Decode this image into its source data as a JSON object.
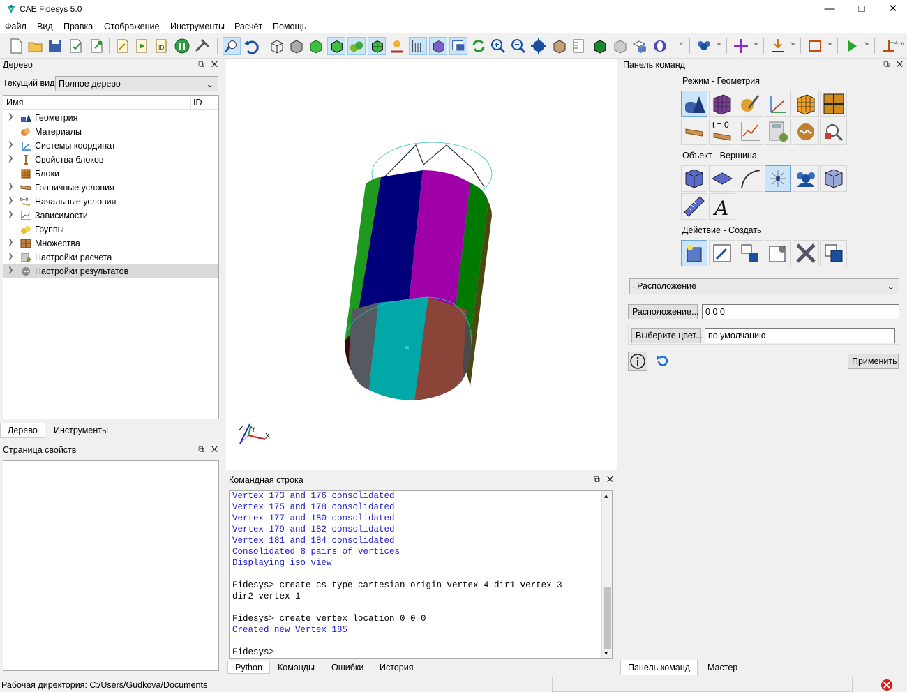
{
  "window": {
    "title": "CAE Fidesys 5.0"
  },
  "menu": [
    "Файл",
    "Вид",
    "Правка",
    "Отображение",
    "Инструменты",
    "Расчёт",
    "Помощь"
  ],
  "tree_panel": {
    "title": "Дерево",
    "view_label": "Текущий вид",
    "view_value": "Полное дерево",
    "col_name": "Имя",
    "col_id": "ID",
    "items": [
      {
        "label": "Геометрия",
        "icon": "geometry-icon"
      },
      {
        "label": "Материалы",
        "icon": "materials-icon"
      },
      {
        "label": "Системы координат",
        "icon": "coordinate-systems-icon"
      },
      {
        "label": "Свойства блоков",
        "icon": "block-properties-icon"
      },
      {
        "label": "Блоки",
        "icon": "blocks-icon"
      },
      {
        "label": "Граничные условия",
        "icon": "boundary-conditions-icon"
      },
      {
        "label": "Начальные условия",
        "icon": "initial-conditions-icon"
      },
      {
        "label": "Зависимости",
        "icon": "dependencies-icon"
      },
      {
        "label": "Группы",
        "icon": "groups-icon"
      },
      {
        "label": "Множества",
        "icon": "sets-icon"
      },
      {
        "label": "Настройки расчета",
        "icon": "calc-settings-icon"
      },
      {
        "label": "Настройки результатов",
        "icon": "results-settings-icon"
      }
    ],
    "tabs": [
      "Дерево",
      "Инструменты"
    ]
  },
  "props_panel": {
    "title": "Страница свойств"
  },
  "cmdline": {
    "title": "Командная строка",
    "lines": [
      {
        "text": "Vertex 173 and 176 consolidated",
        "kind": "out"
      },
      {
        "text": "Vertex 175 and 178 consolidated",
        "kind": "out"
      },
      {
        "text": "Vertex 177 and 180 consolidated",
        "kind": "out"
      },
      {
        "text": "Vertex 179 and 182 consolidated",
        "kind": "out"
      },
      {
        "text": "Vertex 181 and 184 consolidated",
        "kind": "out"
      },
      {
        "text": "Consolidated 8 pairs of vertices",
        "kind": "out"
      },
      {
        "text": "Displaying iso view",
        "kind": "out"
      },
      {
        "text": "",
        "kind": "blank"
      },
      {
        "text": "Fidesys> create cs type cartesian origin vertex 4 dir1 vertex 3",
        "kind": "cmd"
      },
      {
        "text": "dir2 vertex 1",
        "kind": "cmd"
      },
      {
        "text": "",
        "kind": "blank"
      },
      {
        "text": "Fidesys> create vertex location 0 0 0",
        "kind": "cmd"
      },
      {
        "text": "Created new Vertex 185",
        "kind": "out"
      },
      {
        "text": "",
        "kind": "blank"
      },
      {
        "text": "Fidesys>",
        "kind": "cmd"
      }
    ],
    "tabs": [
      "Python",
      "Команды",
      "Ошибки",
      "История"
    ]
  },
  "cmd_panel": {
    "title": "Панель команд",
    "mode_group": "Режим - Геометрия",
    "object_group": "Объект - Вершина",
    "action_group": "Действие - Создать",
    "t0_label": "t = 0",
    "dropdown_value": "Расположение",
    "location_button": "Расположение...",
    "location_value": "0 0 0",
    "color_button": "Выберите цвет...",
    "color_value": "по умолчанию",
    "apply_button": "Применить",
    "tabs": [
      "Панель команд",
      "Мастер"
    ]
  },
  "axes": {
    "x": "X",
    "y": "Y",
    "z": "Z"
  },
  "status": {
    "workdir": "Рабочая директория: C:/Users/Gudkova/Documents"
  }
}
